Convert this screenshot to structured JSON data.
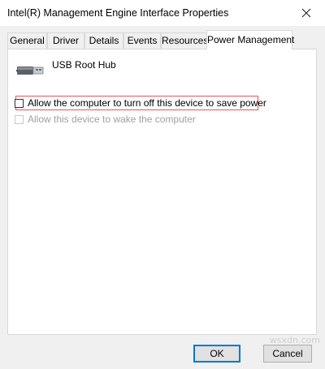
{
  "window": {
    "title": "Intel(R) Management Engine Interface  Properties"
  },
  "tabs": [
    {
      "label": "General"
    },
    {
      "label": "Driver"
    },
    {
      "label": "Details"
    },
    {
      "label": "Events"
    },
    {
      "label": "Resources"
    },
    {
      "label": "Power Management",
      "active": true
    }
  ],
  "device": {
    "name": "USB Root Hub",
    "icon": "usb-plug-icon"
  },
  "options": [
    {
      "label": "Allow the computer to turn off this device to save power",
      "checked": false,
      "enabled": true
    },
    {
      "label": "Allow this device to wake the computer",
      "checked": false,
      "enabled": false
    }
  ],
  "buttons": {
    "ok": "OK",
    "cancel": "Cancel"
  },
  "watermark": "wsxdn.com",
  "colors": {
    "highlight_border": "#e5555b",
    "default_button_border": "#0078d7"
  }
}
